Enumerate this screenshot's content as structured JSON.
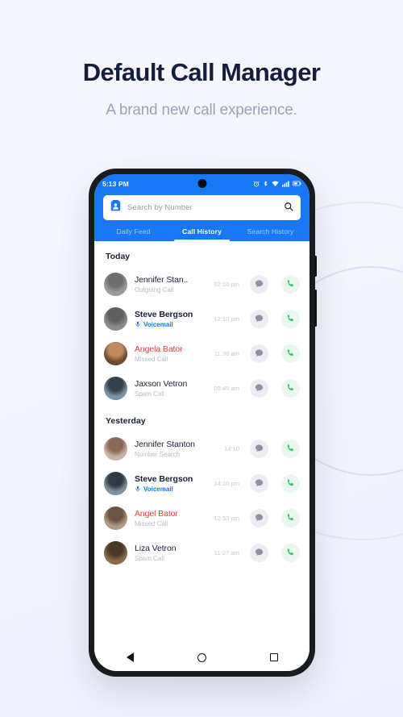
{
  "hero": {
    "title": "Default Call Manager",
    "subtitle": "A brand new call experience."
  },
  "colors": {
    "accent_blue": "#1877f7",
    "missed_red": "#e8413c",
    "call_green": "#22c55e",
    "title_navy": "#161e3d",
    "subtitle_grey": "#9aa3b8",
    "page_bg": "#f4f6fc"
  },
  "phone": {
    "statusbar": {
      "time": "5:13 PM",
      "icons": [
        "alarm-icon",
        "bluetooth-icon",
        "wifi-icon",
        "signal-icon",
        "battery-icon"
      ]
    },
    "search": {
      "placeholder": "Search by Number",
      "leading_icon": "contact-card-icon",
      "trailing_icon": "search-icon"
    },
    "tabs": [
      {
        "label": "Daily Feed",
        "active": false
      },
      {
        "label": "Call History",
        "active": true
      },
      {
        "label": "Search History",
        "active": false
      }
    ],
    "sections": [
      {
        "title": "Today",
        "rows": [
          {
            "name": "Jennifer Stan..",
            "name_style": "normal",
            "subtitle": "Outgoing Call",
            "subtitle_style": "normal",
            "time": "02:10 pm",
            "avatar_bg": "#9b9b9b",
            "avatar_tone": "#6e6e6e"
          },
          {
            "name": "Steve Bergson",
            "name_style": "bold",
            "subtitle": "Voicemail",
            "subtitle_style": "voicemail",
            "time": "12:10 pm",
            "avatar_bg": "#8c8c8c",
            "avatar_tone": "#5f5f5f"
          },
          {
            "name": "Angela Bator",
            "name_style": "missed",
            "subtitle": "Missed Call",
            "subtitle_style": "normal",
            "time": "11:38 am",
            "avatar_bg": "#6d4b33",
            "avatar_tone": "#c08a5e"
          },
          {
            "name": "Jaxson Vetron",
            "name_style": "normal",
            "subtitle": "Spam Call",
            "subtitle_style": "normal",
            "time": "09:45 am",
            "avatar_bg": "#7d93a6",
            "avatar_tone": "#33414d"
          }
        ]
      },
      {
        "title": "Yesterday",
        "rows": [
          {
            "name": "Jennifer Stanton",
            "name_style": "normal",
            "subtitle": "Number Search",
            "subtitle_style": "normal",
            "time": "14:10",
            "avatar_bg": "#c9b3a6",
            "avatar_tone": "#8a6a57"
          },
          {
            "name": "Steve Bergson",
            "name_style": "bold",
            "subtitle": "Voicemail",
            "subtitle_style": "voicemail",
            "time": "14:10 pm",
            "avatar_bg": "#7f8f9c",
            "avatar_tone": "#2f3a44"
          },
          {
            "name": "Angel Bator",
            "name_style": "missed",
            "subtitle": "Missed Call",
            "subtitle_style": "normal",
            "time": "12:53 pm",
            "avatar_bg": "#b09b86",
            "avatar_tone": "#6b5340"
          },
          {
            "name": "Liza Vetron",
            "name_style": "normal",
            "subtitle": "Spam Call",
            "subtitle_style": "normal",
            "time": "11:27 am",
            "avatar_bg": "#8a6b4a",
            "avatar_tone": "#4a3824"
          }
        ]
      }
    ],
    "row_actions": {
      "message_icon": "message-bubble-icon",
      "call_icon": "phone-handset-icon"
    },
    "navbar": {
      "back": "back-triangle-icon",
      "home": "home-circle-icon",
      "recents": "recents-square-icon"
    }
  }
}
